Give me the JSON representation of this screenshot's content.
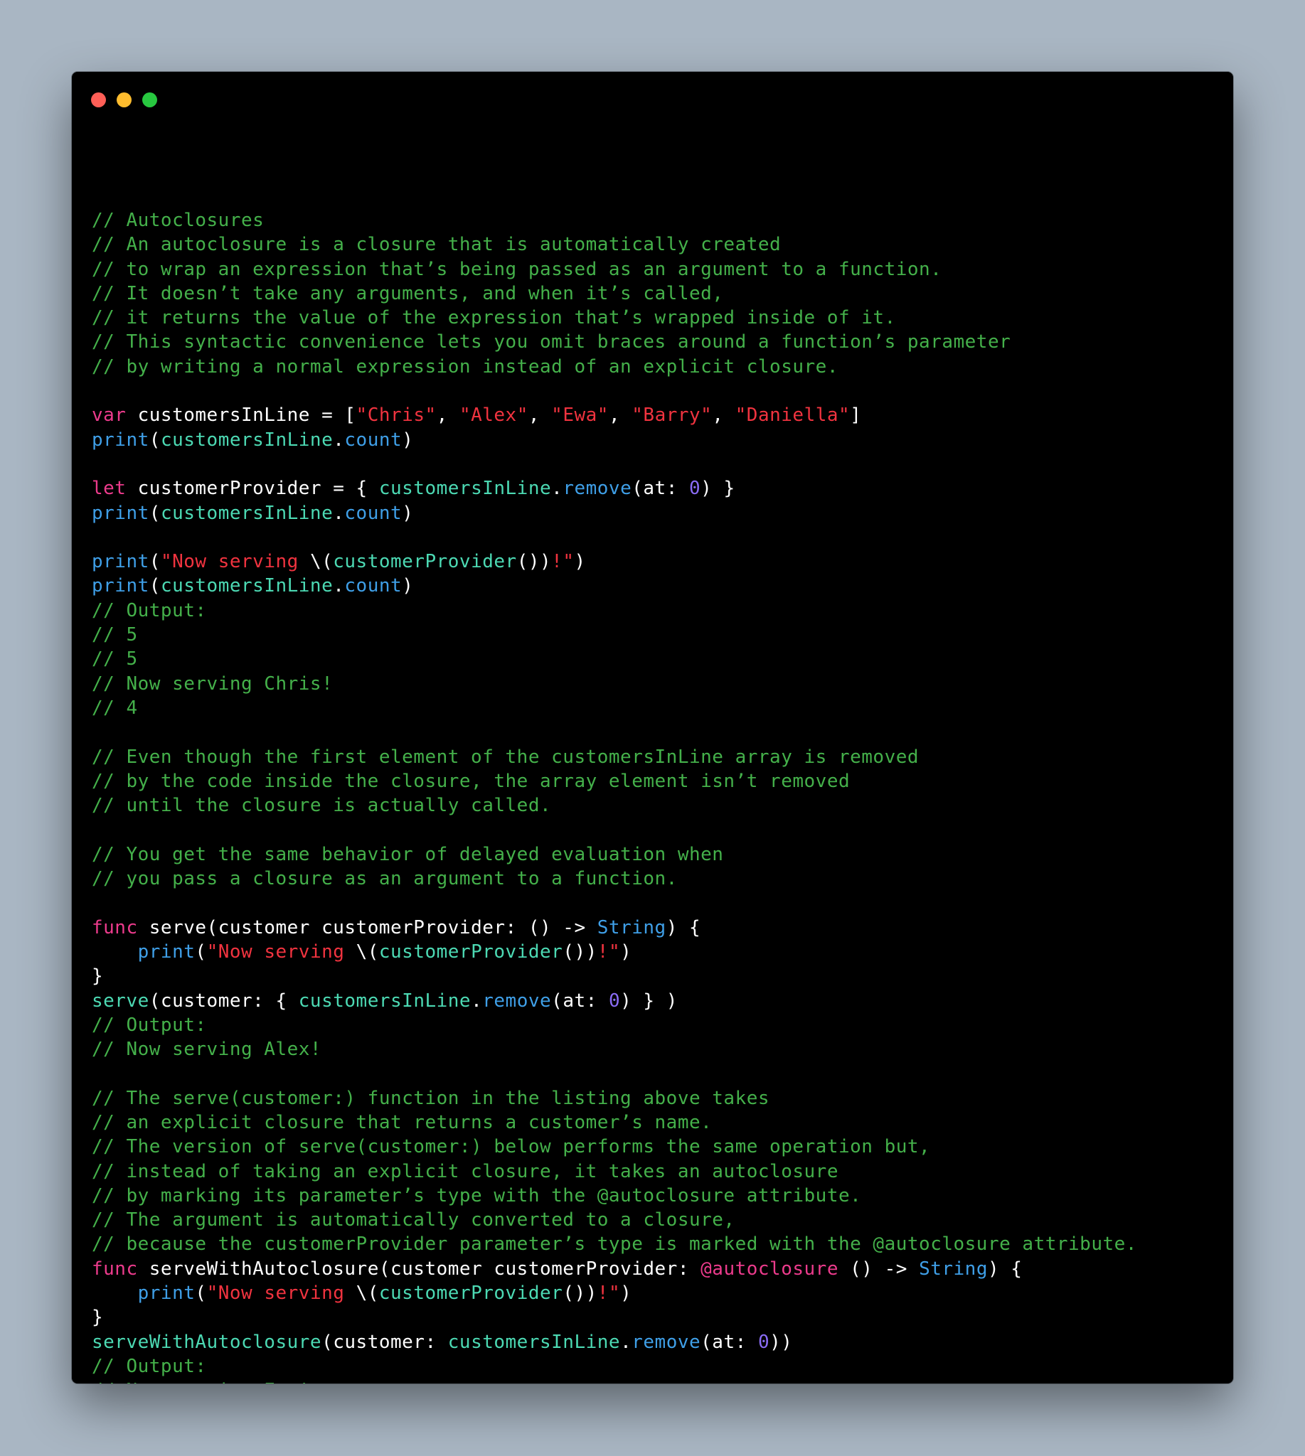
{
  "window": {
    "controls": [
      "close",
      "minimize",
      "zoom"
    ],
    "colors": {
      "background": "#000000",
      "comment": "#44b04a",
      "keyword": "#ec3b8c",
      "function": "#3f9fe7",
      "identifier": "#4cd9b3",
      "string": "#f0333f",
      "number": "#8a6cf5",
      "plain": "#ffffff"
    }
  },
  "code": {
    "lines": [
      [
        {
          "t": "cm",
          "s": "// Autoclosures"
        }
      ],
      [
        {
          "t": "cm",
          "s": "// An autoclosure is a closure that is automatically created"
        }
      ],
      [
        {
          "t": "cm",
          "s": "// to wrap an expression that’s being passed as an argument to a function."
        }
      ],
      [
        {
          "t": "cm",
          "s": "// It doesn’t take any arguments, and when it’s called,"
        }
      ],
      [
        {
          "t": "cm",
          "s": "// it returns the value of the expression that’s wrapped inside of it."
        }
      ],
      [
        {
          "t": "cm",
          "s": "// This syntactic convenience lets you omit braces around a function’s parameter"
        }
      ],
      [
        {
          "t": "cm",
          "s": "// by writing a normal expression instead of an explicit closure."
        }
      ],
      [],
      [
        {
          "t": "kw",
          "s": "var"
        },
        {
          "t": "pl",
          "s": " customersInLine = ["
        },
        {
          "t": "st",
          "s": "\"Chris\""
        },
        {
          "t": "pl",
          "s": ", "
        },
        {
          "t": "st",
          "s": "\"Alex\""
        },
        {
          "t": "pl",
          "s": ", "
        },
        {
          "t": "st",
          "s": "\"Ewa\""
        },
        {
          "t": "pl",
          "s": ", "
        },
        {
          "t": "st",
          "s": "\"Barry\""
        },
        {
          "t": "pl",
          "s": ", "
        },
        {
          "t": "st",
          "s": "\"Daniella\""
        },
        {
          "t": "pl",
          "s": "]"
        }
      ],
      [
        {
          "t": "fn",
          "s": "print"
        },
        {
          "t": "pl",
          "s": "("
        },
        {
          "t": "id",
          "s": "customersInLine"
        },
        {
          "t": "pl",
          "s": "."
        },
        {
          "t": "fn",
          "s": "count"
        },
        {
          "t": "pl",
          "s": ")"
        }
      ],
      [],
      [
        {
          "t": "kw",
          "s": "let"
        },
        {
          "t": "pl",
          "s": " customerProvider = { "
        },
        {
          "t": "id",
          "s": "customersInLine"
        },
        {
          "t": "pl",
          "s": "."
        },
        {
          "t": "fn",
          "s": "remove"
        },
        {
          "t": "pl",
          "s": "(at: "
        },
        {
          "t": "nm",
          "s": "0"
        },
        {
          "t": "pl",
          "s": ") }"
        }
      ],
      [
        {
          "t": "fn",
          "s": "print"
        },
        {
          "t": "pl",
          "s": "("
        },
        {
          "t": "id",
          "s": "customersInLine"
        },
        {
          "t": "pl",
          "s": "."
        },
        {
          "t": "fn",
          "s": "count"
        },
        {
          "t": "pl",
          "s": ")"
        }
      ],
      [],
      [
        {
          "t": "fn",
          "s": "print"
        },
        {
          "t": "pl",
          "s": "("
        },
        {
          "t": "st",
          "s": "\"Now serving "
        },
        {
          "t": "pl",
          "s": "\\("
        },
        {
          "t": "id",
          "s": "customerProvider"
        },
        {
          "t": "pl",
          "s": "())"
        },
        {
          "t": "st",
          "s": "!\""
        },
        {
          "t": "pl",
          "s": ")"
        }
      ],
      [
        {
          "t": "fn",
          "s": "print"
        },
        {
          "t": "pl",
          "s": "("
        },
        {
          "t": "id",
          "s": "customersInLine"
        },
        {
          "t": "pl",
          "s": "."
        },
        {
          "t": "fn",
          "s": "count"
        },
        {
          "t": "pl",
          "s": ")"
        }
      ],
      [
        {
          "t": "cm",
          "s": "// Output:"
        }
      ],
      [
        {
          "t": "cm",
          "s": "// 5"
        }
      ],
      [
        {
          "t": "cm",
          "s": "// 5"
        }
      ],
      [
        {
          "t": "cm",
          "s": "// Now serving Chris!"
        }
      ],
      [
        {
          "t": "cm",
          "s": "// 4"
        }
      ],
      [],
      [
        {
          "t": "cm",
          "s": "// Even though the first element of the customersInLine array is removed"
        }
      ],
      [
        {
          "t": "cm",
          "s": "// by the code inside the closure, the array element isn’t removed"
        }
      ],
      [
        {
          "t": "cm",
          "s": "// until the closure is actually called."
        }
      ],
      [],
      [
        {
          "t": "cm",
          "s": "// You get the same behavior of delayed evaluation when"
        }
      ],
      [
        {
          "t": "cm",
          "s": "// you pass a closure as an argument to a function."
        }
      ],
      [],
      [
        {
          "t": "kw",
          "s": "func"
        },
        {
          "t": "pl",
          "s": " serve(customer customerProvider: () -> "
        },
        {
          "t": "tp",
          "s": "String"
        },
        {
          "t": "pl",
          "s": ") {"
        }
      ],
      [
        {
          "t": "pl",
          "s": "    "
        },
        {
          "t": "fn",
          "s": "print"
        },
        {
          "t": "pl",
          "s": "("
        },
        {
          "t": "st",
          "s": "\"Now serving "
        },
        {
          "t": "pl",
          "s": "\\("
        },
        {
          "t": "id",
          "s": "customerProvider"
        },
        {
          "t": "pl",
          "s": "())"
        },
        {
          "t": "st",
          "s": "!\""
        },
        {
          "t": "pl",
          "s": ")"
        }
      ],
      [
        {
          "t": "pl",
          "s": "}"
        }
      ],
      [
        {
          "t": "id",
          "s": "serve"
        },
        {
          "t": "pl",
          "s": "(customer: { "
        },
        {
          "t": "id",
          "s": "customersInLine"
        },
        {
          "t": "pl",
          "s": "."
        },
        {
          "t": "fn",
          "s": "remove"
        },
        {
          "t": "pl",
          "s": "(at: "
        },
        {
          "t": "nm",
          "s": "0"
        },
        {
          "t": "pl",
          "s": ") } )"
        }
      ],
      [
        {
          "t": "cm",
          "s": "// Output:"
        }
      ],
      [
        {
          "t": "cm",
          "s": "// Now serving Alex!"
        }
      ],
      [],
      [
        {
          "t": "cm",
          "s": "// The serve(customer:) function in the listing above takes"
        }
      ],
      [
        {
          "t": "cm",
          "s": "// an explicit closure that returns a customer’s name."
        }
      ],
      [
        {
          "t": "cm",
          "s": "// The version of serve(customer:) below performs the same operation but,"
        }
      ],
      [
        {
          "t": "cm",
          "s": "// instead of taking an explicit closure, it takes an autoclosure"
        }
      ],
      [
        {
          "t": "cm",
          "s": "// by marking its parameter’s type with the @autoclosure attribute."
        }
      ],
      [
        {
          "t": "cm",
          "s": "// The argument is automatically converted to a closure,"
        }
      ],
      [
        {
          "t": "cm",
          "s": "// because the customerProvider parameter’s type is marked with the @autoclosure attribute."
        }
      ],
      [
        {
          "t": "kw",
          "s": "func"
        },
        {
          "t": "pl",
          "s": " serveWithAutoclosure(customer customerProvider: "
        },
        {
          "t": "at",
          "s": "@autoclosure"
        },
        {
          "t": "pl",
          "s": " () -> "
        },
        {
          "t": "tp",
          "s": "String"
        },
        {
          "t": "pl",
          "s": ") {"
        }
      ],
      [
        {
          "t": "pl",
          "s": "    "
        },
        {
          "t": "fn",
          "s": "print"
        },
        {
          "t": "pl",
          "s": "("
        },
        {
          "t": "st",
          "s": "\"Now serving "
        },
        {
          "t": "pl",
          "s": "\\("
        },
        {
          "t": "id",
          "s": "customerProvider"
        },
        {
          "t": "pl",
          "s": "())"
        },
        {
          "t": "st",
          "s": "!\""
        },
        {
          "t": "pl",
          "s": ")"
        }
      ],
      [
        {
          "t": "pl",
          "s": "}"
        }
      ],
      [
        {
          "t": "id",
          "s": "serveWithAutoclosure"
        },
        {
          "t": "pl",
          "s": "(customer: "
        },
        {
          "t": "id",
          "s": "customersInLine"
        },
        {
          "t": "pl",
          "s": "."
        },
        {
          "t": "fn",
          "s": "remove"
        },
        {
          "t": "pl",
          "s": "(at: "
        },
        {
          "t": "nm",
          "s": "0"
        },
        {
          "t": "pl",
          "s": "))"
        }
      ],
      [
        {
          "t": "cm",
          "s": "// Output:"
        }
      ],
      [
        {
          "t": "cm",
          "s": "// Now serving Ewa!"
        }
      ]
    ]
  }
}
